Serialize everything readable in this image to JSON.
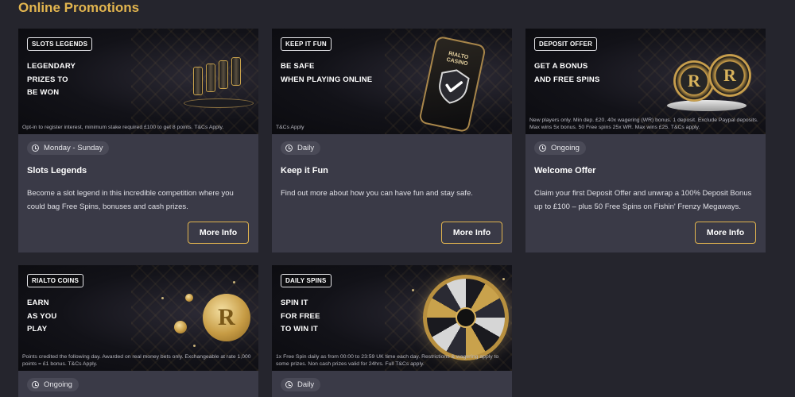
{
  "section": {
    "title": "Online Promotions"
  },
  "cards": [
    {
      "badge": "SLOTS LEGENDS",
      "headline": [
        "LEGENDARY",
        "PRIZES TO",
        "BE WON"
      ],
      "terms": "Opt-in to register interest, minimum stake required £100 to get 8 points. T&Cs Apply.",
      "tag": "Monday - Sunday",
      "title": "Slots Legends",
      "description": "Become a slot legend in this incredible competition where you could bag Free Spins, bonuses and cash prizes.",
      "button": "More Info"
    },
    {
      "badge": "KEEP IT FUN",
      "headline": [
        "BE SAFE",
        "WHEN PLAYING ONLINE"
      ],
      "terms": "T&Cs Apply",
      "tag": "Daily",
      "title": "Keep it Fun",
      "description": "Find out more about how you can have fun and stay safe.",
      "button": "More Info",
      "art_text": "RIALTO CASINO"
    },
    {
      "badge": "DEPOSIT OFFER",
      "headline": [
        "GET A BONUS",
        "AND FREE SPINS"
      ],
      "terms": "New players only. Min dep. £20. 40x wagering (WR) bonus. 1 deposit. Exclude Paypal deposits. Max wins 5x bonus. 50 Free spins 25x WR. Max wins £25. T&Cs apply.",
      "tag": "Ongoing",
      "title": "Welcome Offer",
      "description": "Claim your first Deposit Offer and unwrap a 100% Deposit Bonus up to £100 – plus 50 Free Spins on Fishin' Frenzy Megaways.",
      "button": "More Info",
      "art_text": "R"
    },
    {
      "badge": "RIALTO COINS",
      "headline": [
        "EARN",
        "AS YOU",
        "PLAY"
      ],
      "terms": "Points credited the following day. Awarded on real money bets only. Exchangeable at rate 1,000 points = £1 bonus. T&Cs Apply.",
      "tag": "Ongoing",
      "art_text": "R"
    },
    {
      "badge": "DAILY SPINS",
      "headline": [
        "SPIN IT",
        "FOR FREE",
        "TO WIN IT"
      ],
      "terms": "1x Free Spin daily as from 00:00 to 23:59 UK time each day. Restrictions & wagering apply to some prizes. Non cash prizes valid for 24hrs. Full T&Cs apply.",
      "tag": "Daily"
    }
  ],
  "colors": {
    "accent": "#e2b54f",
    "card_bg": "#3a3a47",
    "page_bg": "#25252d"
  },
  "icons": {
    "tag_icon": "clock-icon"
  }
}
